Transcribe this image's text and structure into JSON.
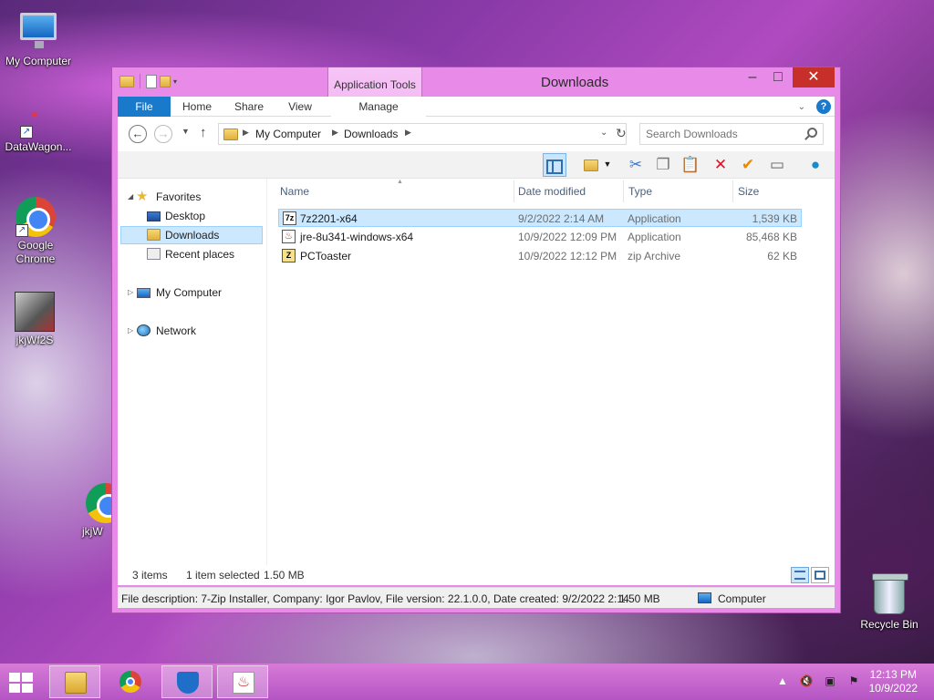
{
  "desktop": {
    "icons": [
      {
        "label": "My Computer"
      },
      {
        "label": "DataWagon..."
      },
      {
        "label": "Google Chrome"
      },
      {
        "label": "jkjWf2S"
      },
      {
        "label": "jkjW"
      },
      {
        "label": "Recycle Bin"
      }
    ]
  },
  "window": {
    "title": "Downloads",
    "context_tab_group": "Application Tools",
    "controls": {
      "minimize": "–",
      "maximize": "□",
      "close": "✕"
    },
    "ribbon_tabs": {
      "file": "File",
      "home": "Home",
      "share": "Share",
      "view": "View",
      "manage": "Manage"
    },
    "address": {
      "crumbs": [
        "My Computer",
        "Downloads"
      ]
    },
    "search": {
      "placeholder": "Search Downloads"
    },
    "nav_pane": {
      "favorites": "Favorites",
      "desktop": "Desktop",
      "downloads": "Downloads",
      "recent": "Recent places",
      "my_computer": "My Computer",
      "network": "Network"
    },
    "columns": {
      "name": "Name",
      "date": "Date modified",
      "type": "Type",
      "size": "Size"
    },
    "files": [
      {
        "name": "7z2201-x64",
        "date": "9/2/2022 2:14 AM",
        "type": "Application",
        "size": "1,539 KB",
        "icon": "7z",
        "selected": true
      },
      {
        "name": "jre-8u341-windows-x64",
        "date": "10/9/2022 12:09 PM",
        "type": "Application",
        "size": "85,468 KB",
        "icon": "java",
        "selected": false
      },
      {
        "name": "PCToaster",
        "date": "10/9/2022 12:12 PM",
        "type": "zip Archive",
        "size": "62 KB",
        "icon": "Z",
        "selected": false
      }
    ],
    "status": {
      "items": "3 items",
      "selection": "1 item selected",
      "selection_size": "1.50 MB"
    },
    "details": {
      "description": "File description: 7-Zip Installer, Company: Igor Pavlov, File version: 22.1.0.0, Date created: 9/2/2022 2:14",
      "size": "1.50 MB",
      "location": "Computer"
    }
  },
  "taskbar": {
    "clock_time": "12:13 PM",
    "clock_date": "10/9/2022"
  },
  "colors": {
    "accent": "#1979ca",
    "window_frame": "#e88ae8",
    "close_button": "#c7302a",
    "selection": "#cce8ff"
  }
}
